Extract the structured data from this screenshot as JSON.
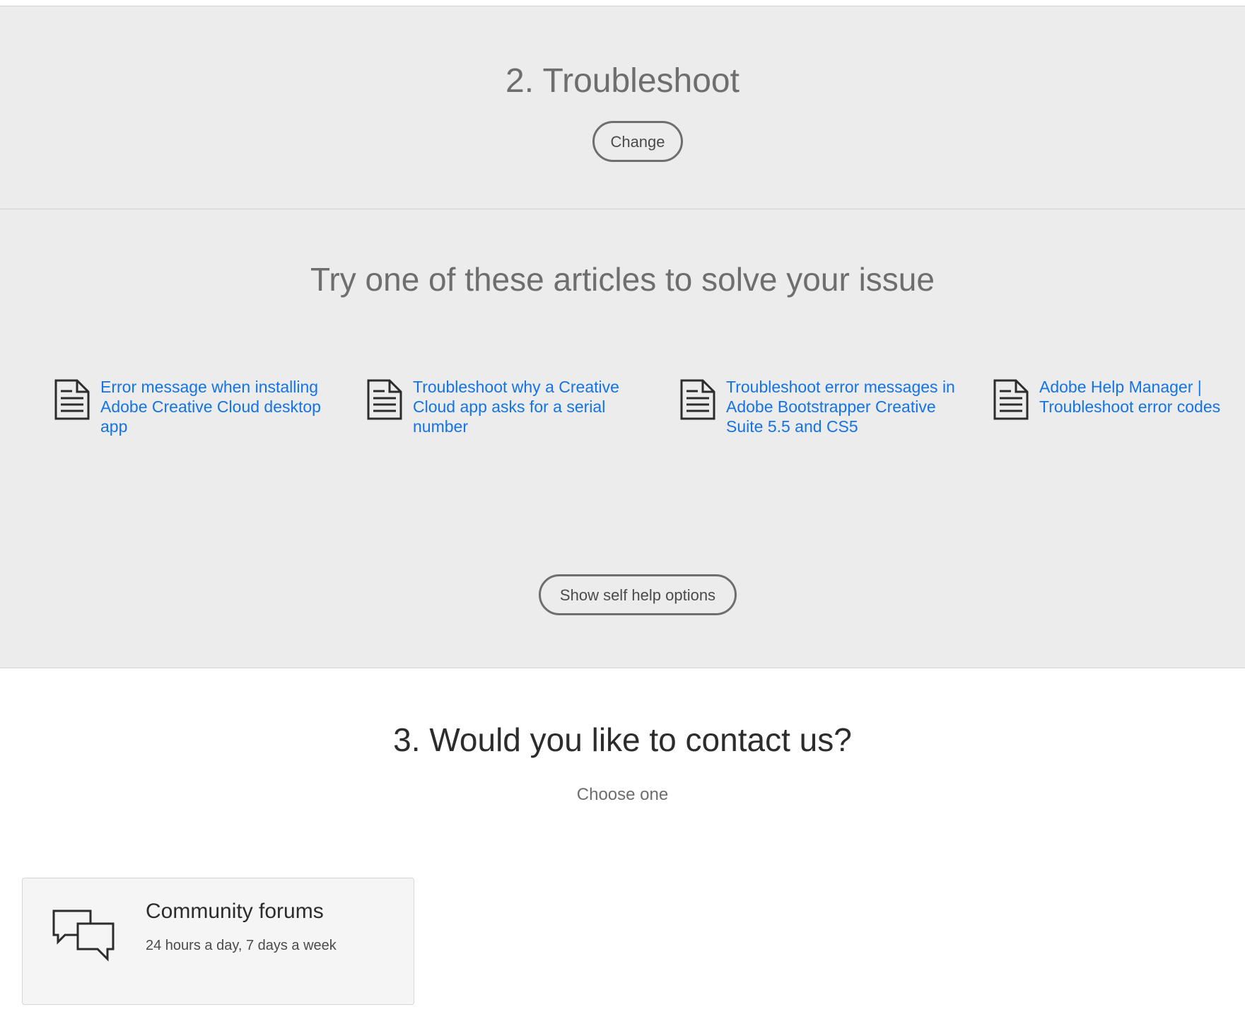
{
  "step2": {
    "title": "2. Troubleshoot",
    "change_label": "Change"
  },
  "articles": {
    "heading": "Try one of these articles to solve your issue",
    "items": [
      {
        "icon": "document-icon",
        "title": "Error message when installing Adobe Creative Cloud desktop app"
      },
      {
        "icon": "document-icon",
        "title": "Troubleshoot why a Creative Cloud app asks for a serial number"
      },
      {
        "icon": "document-icon",
        "title": "Troubleshoot error messages in Adobe Bootstrapper Creative Suite 5.5 and CS5"
      },
      {
        "icon": "document-icon",
        "title": "Adobe Help Manager | Troubleshoot error codes"
      }
    ],
    "show_self_help_label": "Show self help options"
  },
  "step3": {
    "title": "3. Would you like to contact us?",
    "subtitle": "Choose one",
    "options": [
      {
        "icon": "chat-bubbles-icon",
        "title": "Community forums",
        "subtitle": "24 hours a day, 7 days a week"
      }
    ]
  },
  "colors": {
    "link": "#1473e6",
    "section_bg": "#ececec",
    "heading_gray": "#6e6e6e",
    "dark_text": "#2c2c2c"
  }
}
